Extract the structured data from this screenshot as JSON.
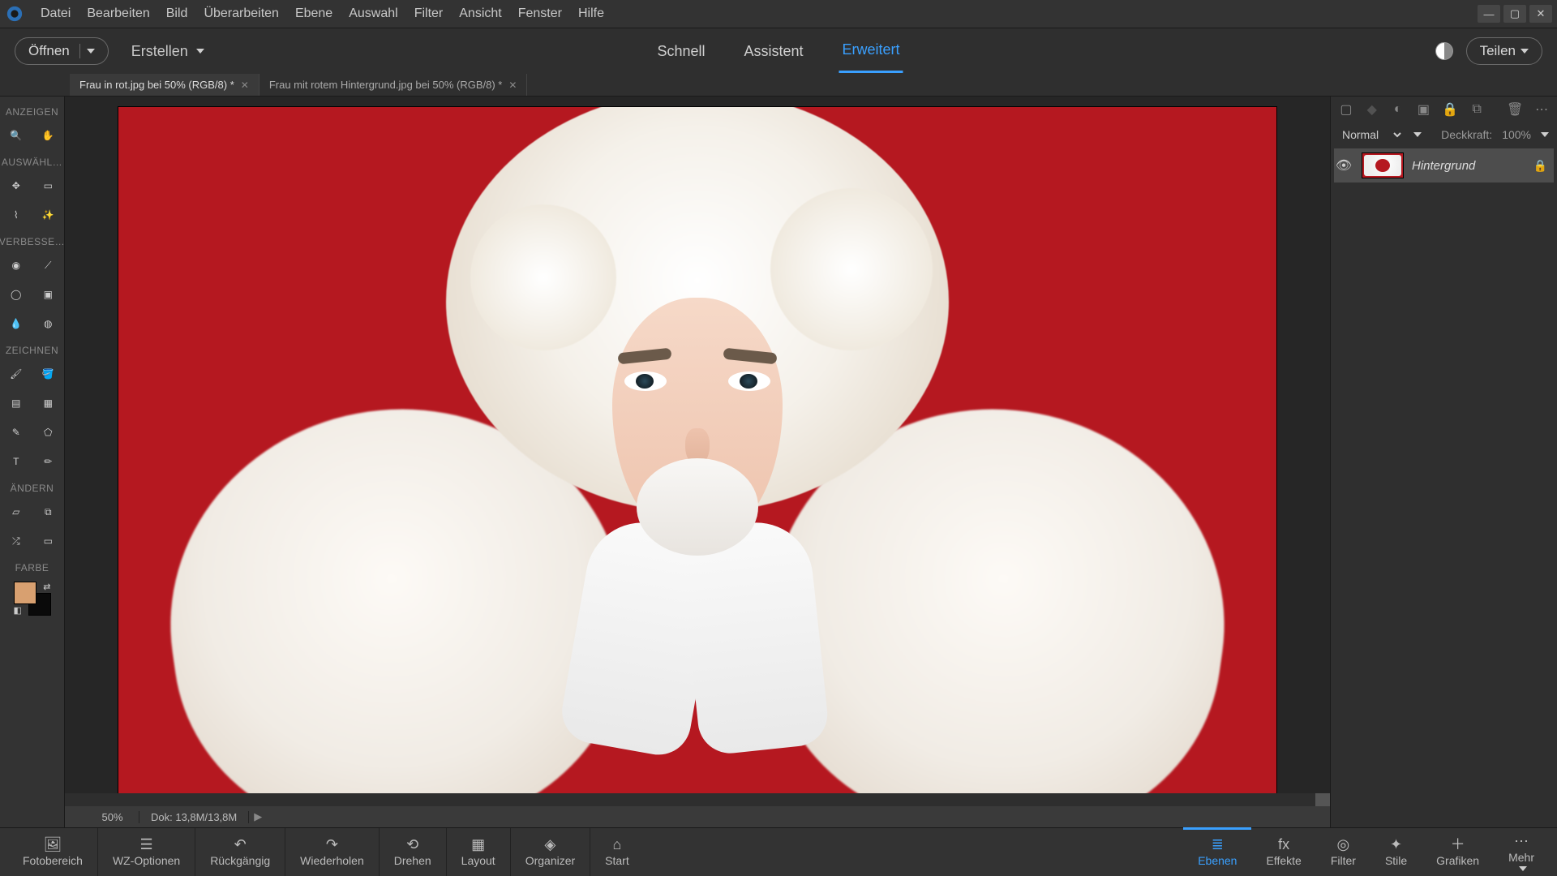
{
  "menu": {
    "items": [
      "Datei",
      "Bearbeiten",
      "Bild",
      "Überarbeiten",
      "Ebene",
      "Auswahl",
      "Filter",
      "Ansicht",
      "Fenster",
      "Hilfe"
    ]
  },
  "secbar": {
    "open": "Öffnen",
    "create": "Erstellen",
    "share": "Teilen",
    "modes": [
      {
        "label": "Schnell"
      },
      {
        "label": "Assistent"
      },
      {
        "label": "Erweitert",
        "active": true
      }
    ]
  },
  "tabs": [
    {
      "label": "Frau in rot.jpg bei 50% (RGB/8) *",
      "active": true
    },
    {
      "label": "Frau mit rotem Hintergrund.jpg bei 50% (RGB/8) *",
      "active": false
    }
  ],
  "toolbox": {
    "sections": [
      {
        "label": "ANZEIGEN",
        "tools": [
          [
            "zoom-icon",
            "🔍"
          ],
          [
            "hand-icon",
            "✋"
          ]
        ]
      },
      {
        "label": "AUSWÄHL…",
        "tools": [
          [
            "move-icon",
            "✥"
          ],
          [
            "marquee-icon",
            "▭"
          ],
          [
            "lasso-icon",
            "⌇"
          ],
          [
            "wand-icon",
            "✨"
          ]
        ]
      },
      {
        "label": "VERBESSE…",
        "tools": [
          [
            "redeye-icon",
            "◉"
          ],
          [
            "straighten-icon",
            "⟋"
          ],
          [
            "spot-icon",
            "◯"
          ],
          [
            "clone-icon",
            "▣"
          ],
          [
            "blur-icon",
            "💧"
          ],
          [
            "sponge-icon",
            "◍"
          ]
        ]
      },
      {
        "label": "ZEICHNEN",
        "tools": [
          [
            "brush-icon",
            "🖌"
          ],
          [
            "bucket-icon",
            "🪣"
          ],
          [
            "fill-icon",
            "▤"
          ],
          [
            "gradient-icon",
            "▦"
          ],
          [
            "dropper-icon",
            "✎"
          ],
          [
            "shape-icon",
            "⬠"
          ],
          [
            "text-icon",
            "T"
          ],
          [
            "pencil-icon",
            "✏"
          ]
        ]
      },
      {
        "label": "ÄNDERN",
        "tools": [
          [
            "crop-icon",
            "▱"
          ],
          [
            "recompose-icon",
            "⧉"
          ],
          [
            "contentmove-icon",
            "⤮"
          ],
          [
            "perspective-icon",
            "▭"
          ]
        ]
      }
    ],
    "colorLabel": "FARBE",
    "fg": "#d8a070",
    "bg": "#0a0a0a"
  },
  "status": {
    "zoom": "50%",
    "dok": "Dok: 13,8M/13,8M"
  },
  "layers": {
    "blend_label": "Normal",
    "opacity_label": "Deckkraft:",
    "opacity_value": "100%",
    "items": [
      {
        "name": "Hintergrund",
        "locked": true
      }
    ]
  },
  "bottom": {
    "left": [
      {
        "id": "fotobereich",
        "label": "Fotobereich",
        "icon": "🖼"
      },
      {
        "id": "wz",
        "label": "WZ-Optionen",
        "icon": "☰"
      },
      {
        "id": "undo",
        "label": "Rückgängig",
        "icon": "↶"
      },
      {
        "id": "redo",
        "label": "Wiederholen",
        "icon": "↷"
      },
      {
        "id": "drehen",
        "label": "Drehen",
        "icon": "⟲"
      },
      {
        "id": "layout",
        "label": "Layout",
        "icon": "▦"
      },
      {
        "id": "organizer",
        "label": "Organizer",
        "icon": "◈"
      },
      {
        "id": "start",
        "label": "Start",
        "icon": "⌂"
      }
    ],
    "right": [
      {
        "id": "ebenen",
        "label": "Ebenen",
        "icon": "≣",
        "active": true
      },
      {
        "id": "effekte",
        "label": "Effekte",
        "icon": "fx"
      },
      {
        "id": "filter",
        "label": "Filter",
        "icon": "◎"
      },
      {
        "id": "stile",
        "label": "Stile",
        "icon": "✦"
      },
      {
        "id": "grafiken",
        "label": "Grafiken",
        "icon": "＋"
      },
      {
        "id": "mehr",
        "label": "Mehr",
        "icon": "⋯"
      }
    ]
  }
}
